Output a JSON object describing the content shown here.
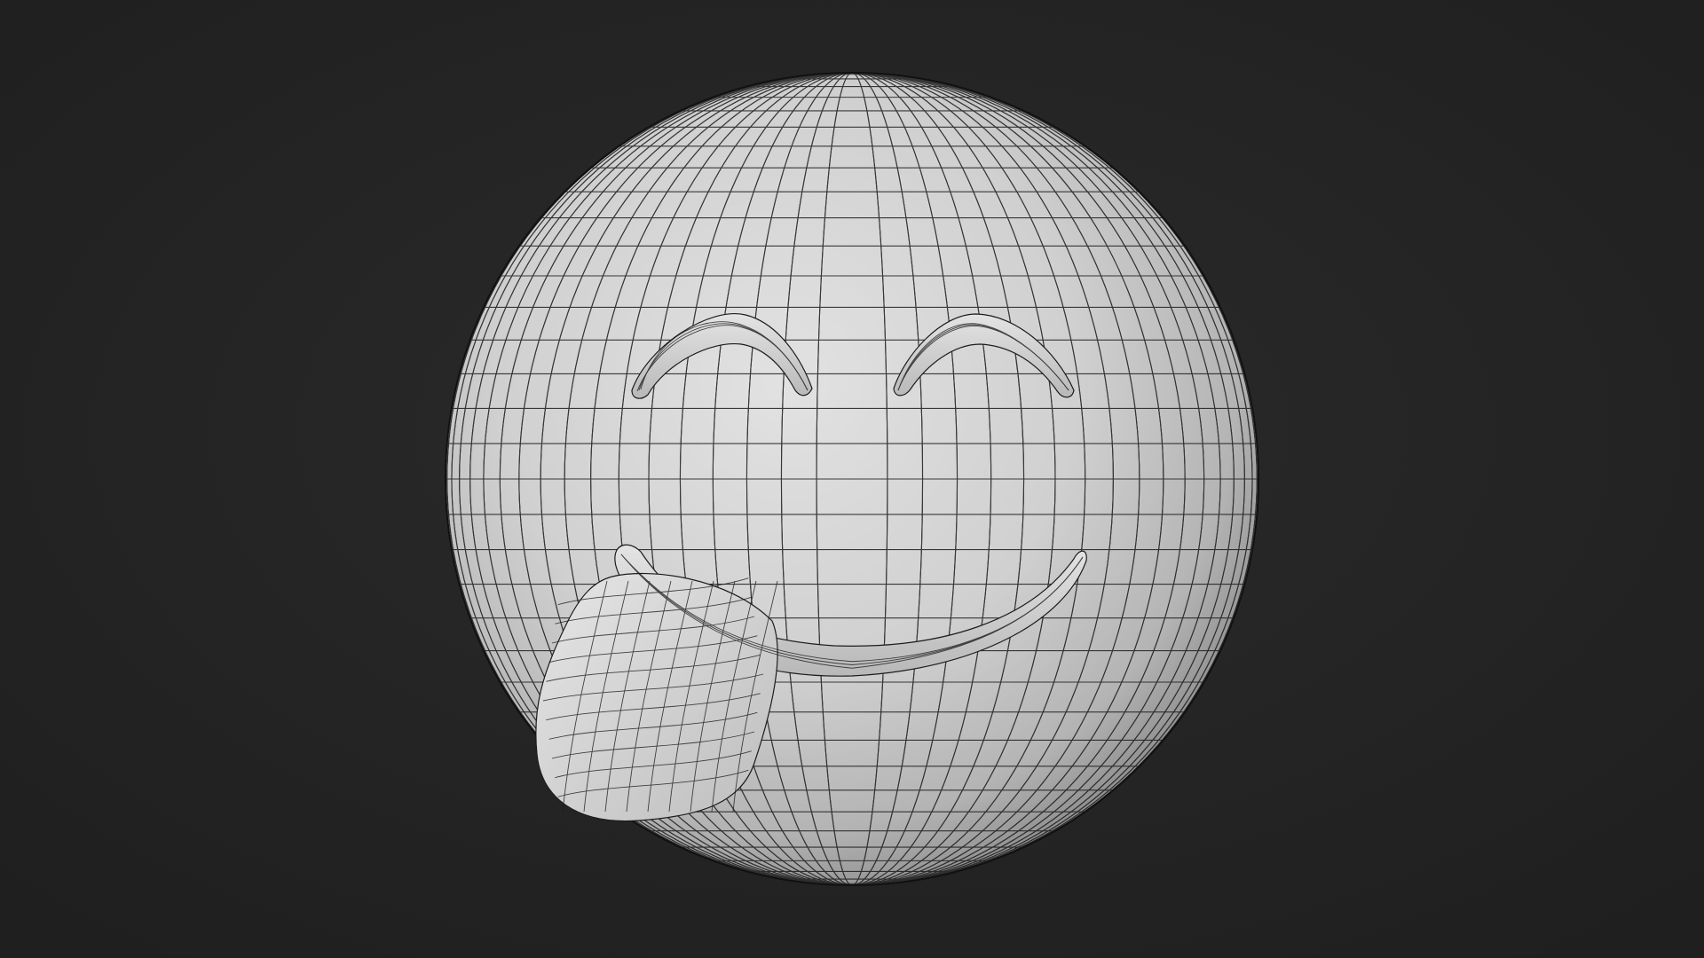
{
  "scene": {
    "subject": "smiling-face-with-tongue-wireframe-icon",
    "background_color": "#242424",
    "surface_color": "#d2d2d2",
    "wire_color": "#1c1c1c",
    "wireframe": true
  }
}
